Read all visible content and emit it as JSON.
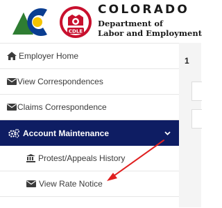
{
  "header": {
    "brand_title": "COLORADO",
    "dept_line1": "Department of",
    "dept_line2": "Labor and Employment",
    "logo_badge_text": "CDLE"
  },
  "sidebar": {
    "items": [
      {
        "label": "Employer Home",
        "icon": "home-icon"
      },
      {
        "label": "View Correspondences",
        "icon": "envelope-icon"
      },
      {
        "label": "Claims Correspondence",
        "icon": "envelope-icon"
      },
      {
        "label": "Account Maintenance",
        "icon": "cogs-icon",
        "active": true,
        "expanded": true
      },
      {
        "label": "Protest/Appeals History",
        "icon": "institution-icon",
        "sub": true
      },
      {
        "label": "View Rate Notice",
        "icon": "envelope-icon",
        "sub": true
      }
    ]
  },
  "right_panel": {
    "digit": "1"
  },
  "colors": {
    "active_bg": "#0e1d63",
    "text": "#3b3b3b",
    "annotation_arrow": "#e02020",
    "logo_red": "#c8102e",
    "logo_green": "#2e7d32",
    "logo_yellow": "#f5c400",
    "logo_blue": "#0a3d91"
  }
}
